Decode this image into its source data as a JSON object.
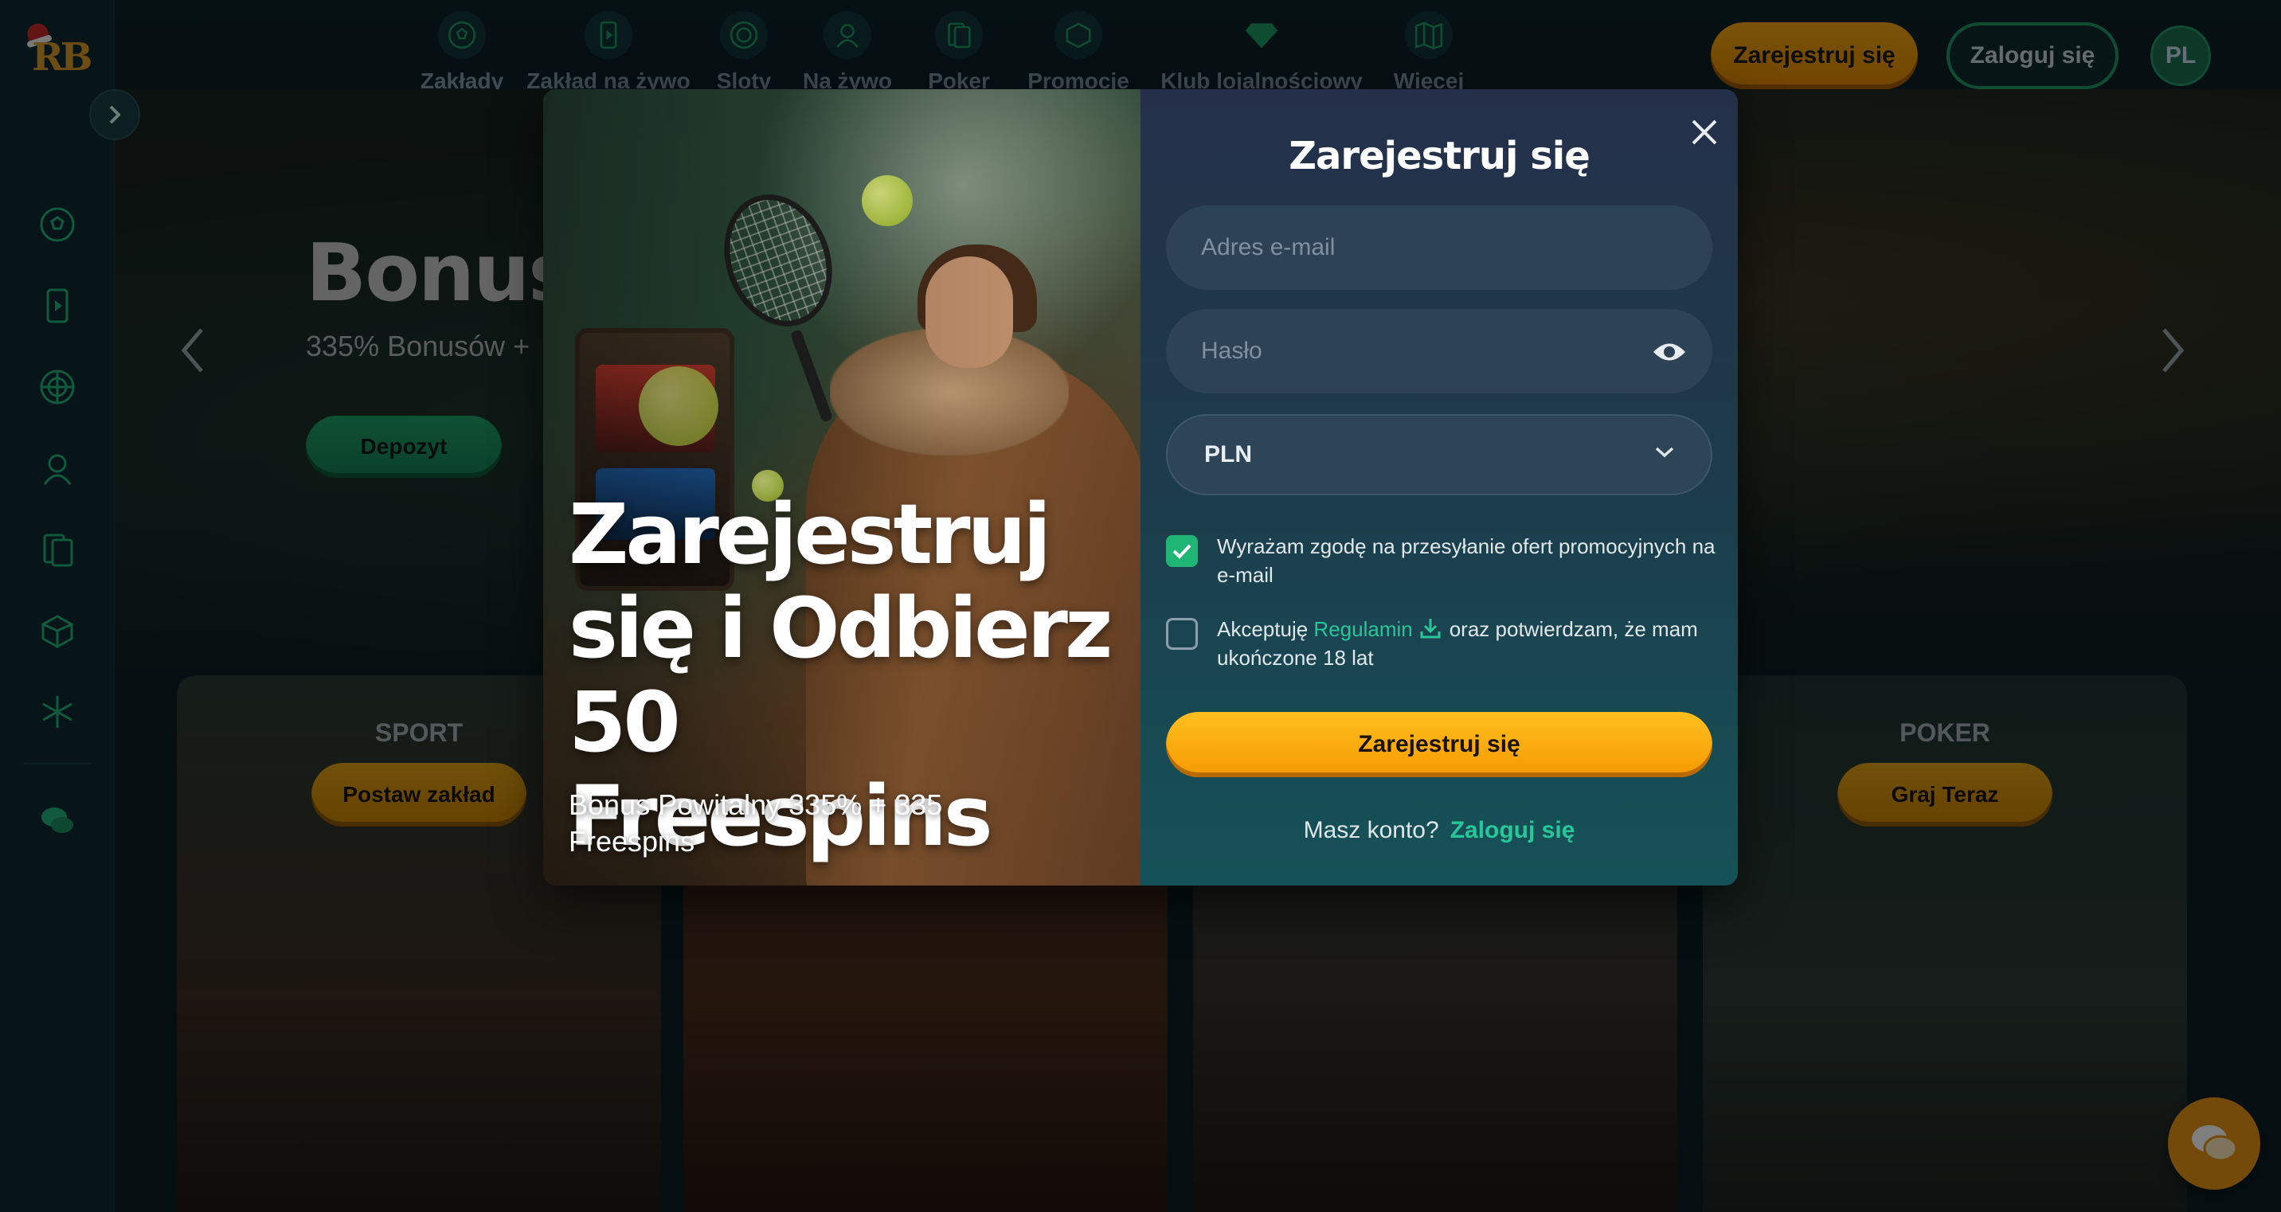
{
  "sidebar": {
    "logo_text": "RB",
    "items": [
      {
        "icon": "soccer-ball-icon"
      },
      {
        "icon": "live-betting-icon"
      },
      {
        "icon": "slots-wheel-icon"
      },
      {
        "icon": "live-dealer-icon"
      },
      {
        "icon": "poker-cards-icon"
      },
      {
        "icon": "promotions-gift-icon"
      },
      {
        "icon": "snowflake-icon"
      },
      {
        "icon": "chat-icon"
      }
    ]
  },
  "topnav": {
    "items": [
      {
        "label": "Zakłady",
        "icon": "soccer-ball-icon"
      },
      {
        "label": "Zakład na żywo",
        "icon": "live-betting-icon"
      },
      {
        "label": "Sloty",
        "icon": "slots-wheel-icon"
      },
      {
        "label": "Na żywo",
        "icon": "live-dealer-icon"
      },
      {
        "label": "Poker",
        "icon": "poker-cards-icon"
      },
      {
        "label": "Promocje",
        "icon": "promotions-gift-icon"
      },
      {
        "label": "Klub lojalnościowy",
        "icon": "diamond-icon"
      },
      {
        "label": "Więcej",
        "icon": "more-map-icon"
      }
    ],
    "register_label": "Zarejestruj się",
    "login_label": "Zaloguj się",
    "language": "PL"
  },
  "hero": {
    "title": "Bonus F",
    "subtitle": "335% Bonusów +",
    "button_label": "Depozyt"
  },
  "cards": [
    {
      "title": "SPORT",
      "button": "Postaw zakład"
    },
    {
      "title": "",
      "button": ""
    },
    {
      "title": "",
      "button": ""
    },
    {
      "title": "POKER",
      "button": "Graj Teraz"
    }
  ],
  "modal": {
    "promo_title": "Zarejestruj się i Odbierz 50 Freespins",
    "promo_subtitle": "Bonus Powitalny 335% + 335 Freespins",
    "form_title": "Zarejestruj się",
    "email_placeholder": "Adres e-mail",
    "password_placeholder": "Hasło",
    "currency": "PLN",
    "consent_marketing": {
      "checked": true,
      "text": "Wyrażam zgodę na przesyłanie ofert promocyjnych na e-mail"
    },
    "consent_terms": {
      "checked": false,
      "text_before": "Akceptuję",
      "link": "Regulamin",
      "text_after": "oraz potwierdzam, że mam ukończone 18 lat"
    },
    "submit_label": "Zarejestruj się",
    "have_account_text": "Masz konto?",
    "login_link": "Zaloguj się"
  },
  "colors": {
    "accent_orange": "#f5a000",
    "accent_green": "#1fb574",
    "link_green": "#27c79a"
  }
}
